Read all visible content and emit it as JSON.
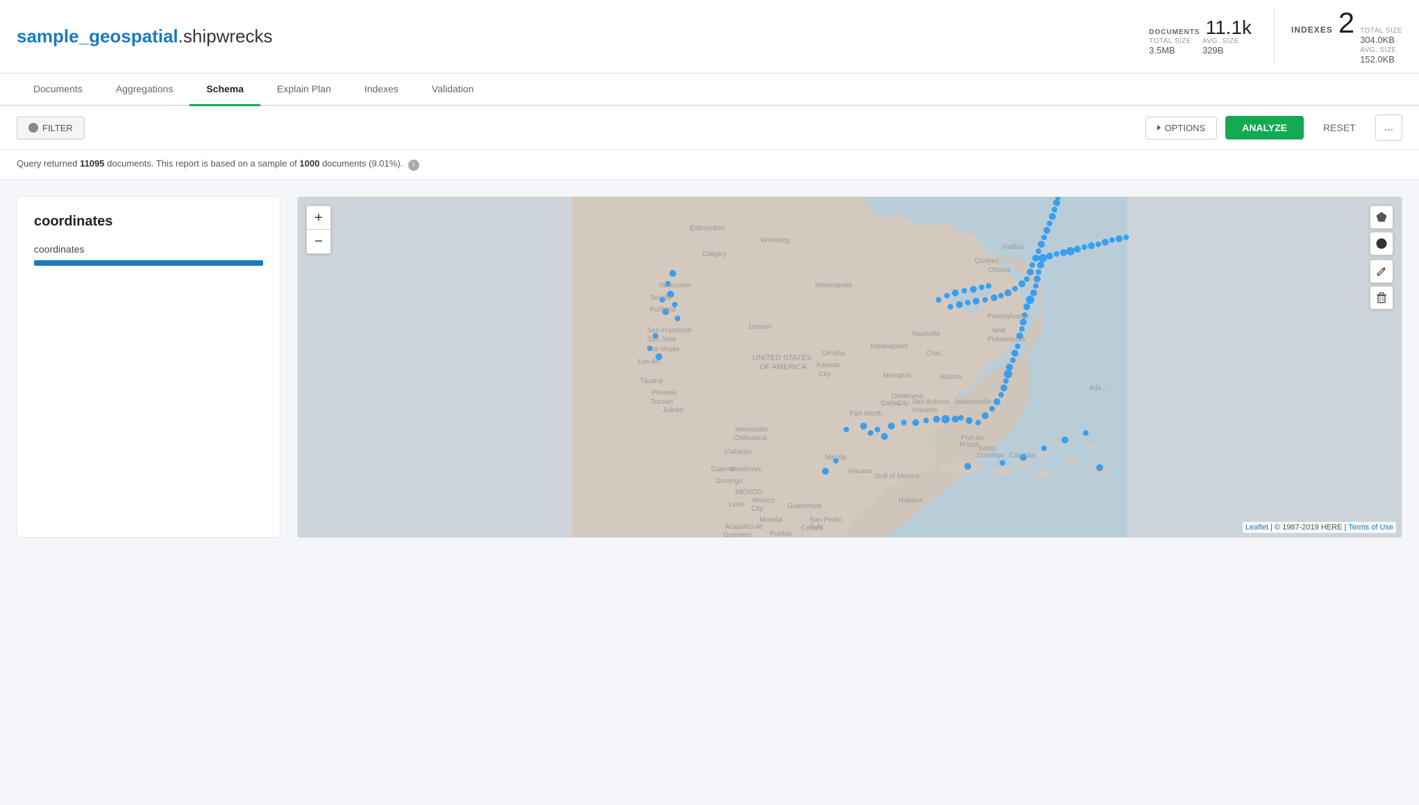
{
  "header": {
    "db_name": "sample_geospatial",
    "separator": ".",
    "collection_name": "shipwrecks",
    "documents_label": "DOCUMENTS",
    "documents_value": "11.1k",
    "total_size_label": "TOTAL SIZE",
    "total_size_value": "3.5MB",
    "avg_size_label": "AVG. SIZE",
    "avg_size_value": "329B",
    "indexes_label": "INDEXES",
    "indexes_value": "2",
    "indexes_total_size_label": "TOTAL SIZE",
    "indexes_total_size_value": "304.0KB",
    "indexes_avg_size_label": "AVG. SIZE",
    "indexes_avg_size_value": "152.0KB"
  },
  "nav": {
    "tabs": [
      {
        "id": "documents",
        "label": "Documents",
        "active": false
      },
      {
        "id": "aggregations",
        "label": "Aggregations",
        "active": false
      },
      {
        "id": "schema",
        "label": "Schema",
        "active": true
      },
      {
        "id": "explain",
        "label": "Explain Plan",
        "active": false
      },
      {
        "id": "indexes",
        "label": "Indexes",
        "active": false
      },
      {
        "id": "validation",
        "label": "Validation",
        "active": false
      }
    ]
  },
  "toolbar": {
    "filter_label": "FILTER",
    "options_label": "OPTIONS",
    "analyze_label": "ANALYZE",
    "reset_label": "RESET",
    "more_label": "..."
  },
  "query_info": {
    "prefix": "Query returned",
    "doc_count": "11095",
    "middle": "documents. This report is based on a sample of",
    "sample_count": "1000",
    "suffix": "documents (9.01%)."
  },
  "schema": {
    "field_title": "coordinates",
    "field_name": "coordinates"
  },
  "map": {
    "attribution_leaflet": "Leaflet",
    "attribution_copyright": "| © 1987-2019 HERE |",
    "attribution_terms": "Terms of Use"
  },
  "colors": {
    "accent_green": "#13aa52",
    "accent_blue": "#1a7abf",
    "dot_blue": "#2196F3",
    "map_bg": "#cdd5db",
    "map_land": "#e8e0d8",
    "map_water": "#b8cdd8"
  }
}
